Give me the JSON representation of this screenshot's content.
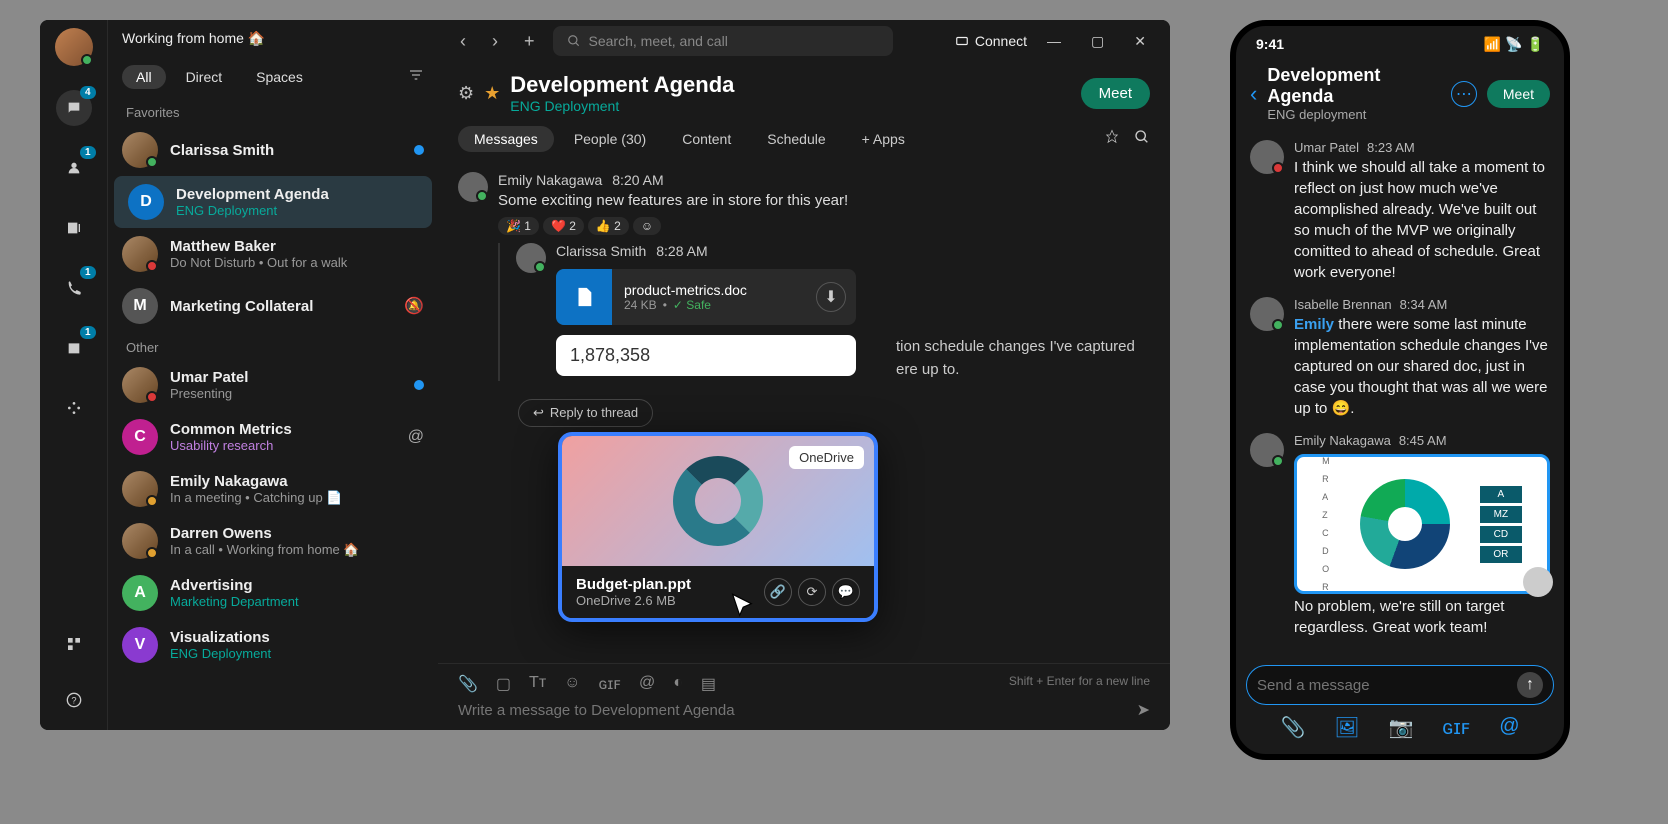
{
  "desktop": {
    "presence": "Working from home 🏠",
    "rail": {
      "messaging_badge": "4",
      "teams_badge": "1",
      "phone_badge": "1",
      "calendar_badge": "1"
    },
    "tabs": {
      "all": "All",
      "direct": "Direct",
      "spaces": "Spaces"
    },
    "search_placeholder": "Search, meet, and call",
    "connect": "Connect",
    "sections": {
      "favorites": "Favorites",
      "other": "Other"
    },
    "contacts": [
      {
        "name": "Clarissa Smith",
        "sub": "",
        "subColor": "gray",
        "dot": "green",
        "unread": true,
        "avatar": "img"
      },
      {
        "name": "Development Agenda",
        "sub": "ENG Deployment",
        "subColor": "teal",
        "initial": "D",
        "bg": "#0d72c4",
        "selected": true
      },
      {
        "name": "Matthew Baker",
        "sub": "Do Not Disturb  •  Out for a walk",
        "subColor": "gray",
        "dot": "red",
        "avatar": "img"
      },
      {
        "name": "Marketing Collateral",
        "sub": "",
        "initial": "M",
        "bg": "#555",
        "mute": true
      }
    ],
    "other_contacts": [
      {
        "name": "Umar Patel",
        "sub": "Presenting",
        "subColor": "gray",
        "dot": "red",
        "unread": true,
        "avatar": "img"
      },
      {
        "name": "Common Metrics",
        "sub": "Usability research",
        "subColor": "purple",
        "initial": "C",
        "bg": "#c02090",
        "mention": true
      },
      {
        "name": "Emily Nakagawa",
        "sub": "In a meeting  •  Catching up 📄",
        "subColor": "gray",
        "dot": "orange",
        "avatar": "img"
      },
      {
        "name": "Darren Owens",
        "sub": "In a call  •  Working from home 🏠",
        "subColor": "gray",
        "dot": "orange",
        "avatar": "img"
      },
      {
        "name": "Advertising",
        "sub": "Marketing Department",
        "subColor": "teal",
        "initial": "A",
        "bg": "#43b25f"
      },
      {
        "name": "Visualizations",
        "sub": "ENG Deployment",
        "subColor": "teal",
        "initial": "V",
        "bg": "#8a3ad0"
      }
    ],
    "space": {
      "title": "Development Agenda",
      "subtitle": "ENG Deployment",
      "meet": "Meet",
      "tabs": {
        "messages": "Messages",
        "people": "People (30)",
        "content": "Content",
        "schedule": "Schedule",
        "apps": "+ Apps"
      }
    },
    "messages": [
      {
        "author": "Emily Nakagawa",
        "time": "8:20 AM",
        "text": "Some exciting new features are in store for this year!",
        "reactions": [
          {
            "e": "🎉",
            "n": "1"
          },
          {
            "e": "❤️",
            "n": "2"
          },
          {
            "e": "👍",
            "n": "2"
          }
        ]
      }
    ],
    "thread_msg": {
      "author": "Clarissa Smith",
      "time": "8:28 AM",
      "file": {
        "name": "product-metrics.doc",
        "size": "24 KB",
        "safe": "Safe"
      },
      "preview_number": "1,878,358",
      "behind_text": "tion schedule changes I've captured ere up to."
    },
    "overlay": {
      "tag": "OneDrive",
      "name": "Budget-plan.ppt",
      "sub": "OneDrive 2.6 MB"
    },
    "reply_thread": "Reply to thread",
    "composer": {
      "placeholder": "Write a message to Development Agenda",
      "hint": "Shift + Enter for a new line"
    }
  },
  "phone": {
    "time": "9:41",
    "title": "Development Agenda",
    "subtitle": "ENG deployment",
    "meet": "Meet",
    "messages": [
      {
        "author": "Umar Patel",
        "time": "8:23 AM",
        "dot": "red",
        "text": "I think we should all take a moment to reflect on just how much we've acomplished already. We've built out so much of the MVP we originally comitted to ahead of schedule. Great work everyone!"
      },
      {
        "author": "Isabelle Brennan",
        "time": "8:34 AM",
        "dot": "green",
        "mention": "Emily",
        "text": " there were some last minute implementation schedule changes I've captured on our shared doc, just in case you thought that was all we were up to 😄."
      },
      {
        "author": "Emily Nakagawa",
        "time": "8:45 AM",
        "dot": "green",
        "chart": true,
        "text2": "No problem, we're still on target regardless. Great work team!"
      }
    ],
    "chart_legend": [
      "A",
      "MZ",
      "CD",
      "OR"
    ],
    "chart_axis": [
      "M",
      "R",
      "A",
      "Z",
      "C",
      "D",
      "O",
      "R"
    ],
    "composer_placeholder": "Send a message"
  },
  "chart_data": {
    "type": "pie",
    "title": "",
    "series": [
      {
        "name": "A",
        "value": 25
      },
      {
        "name": "MZ",
        "value": 30
      },
      {
        "name": "CD",
        "value": 22
      },
      {
        "name": "OR",
        "value": 23
      }
    ]
  }
}
